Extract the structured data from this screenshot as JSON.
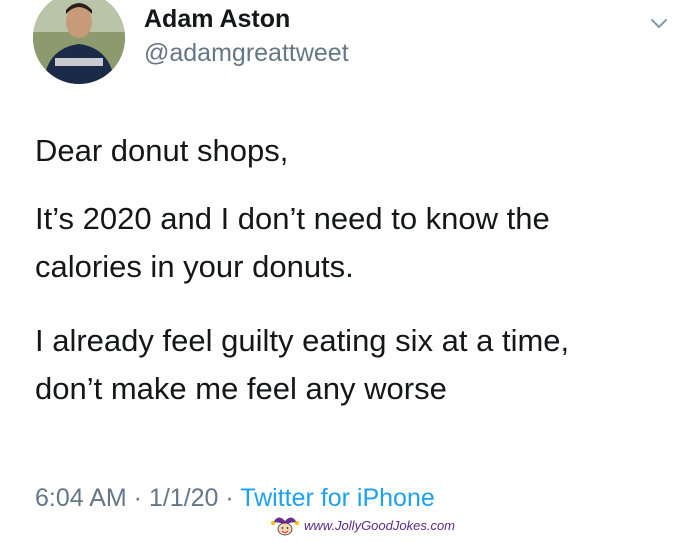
{
  "tweet": {
    "display_name": "Adam Aston",
    "handle": "@adamgreattweet",
    "text": {
      "line1": "Dear donut shops,",
      "line2": "It’s 2020 and I don’t need to know the",
      "line3": "calories in your donuts.",
      "line4": "I already feel guilty eating six at a time,",
      "line5": "don’t make me feel any worse"
    },
    "time": "6:04 AM",
    "sep1": " · ",
    "date": "1/1/20",
    "sep2": " · ",
    "source": "Twitter for iPhone"
  },
  "watermark": {
    "text": "www.JollyGoodJokes.com",
    "icon": "jester-logo-icon"
  },
  "colors": {
    "text": "#14171a",
    "secondary": "#657786",
    "link": "#1da1f2"
  }
}
